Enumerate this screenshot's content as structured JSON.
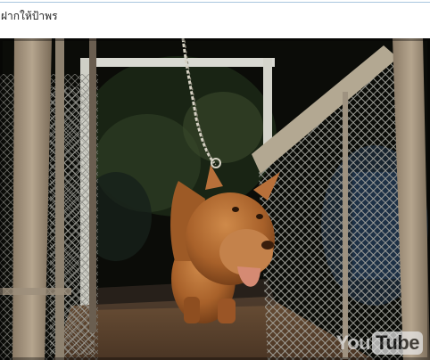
{
  "post": {
    "title": "ฝากให้ป้าพร"
  },
  "video": {
    "logo_you": "You",
    "logo_tube": "Tube"
  },
  "colors": {
    "rule": "#a9c6de",
    "dog": "#b06a30"
  }
}
